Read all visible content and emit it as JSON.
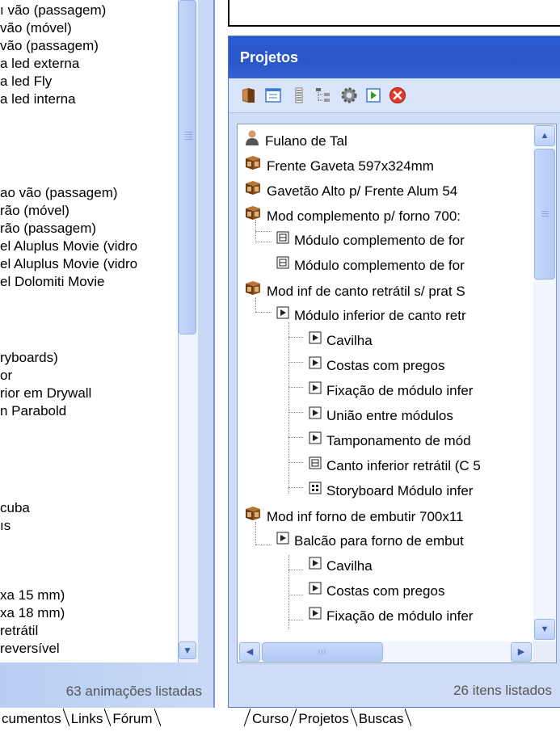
{
  "left_panel": {
    "items": [
      "ı vão (passagem)",
      "vão (móvel)",
      "vão (passagem)",
      "a led externa",
      "a led Fly",
      "a led interna",
      "",
      "",
      "",
      "ao vão (passagem)",
      "rão (móvel)",
      "rão (passagem)",
      "el Aluplus Movie (vidro",
      "el Aluplus Movie (vidro",
      "el Dolomiti Movie",
      "",
      "",
      "ryboards)",
      "or",
      "rior em Drywall",
      "n Parabold",
      "",
      "",
      "",
      "",
      " cuba",
      "ıs",
      "",
      "",
      "xa 15 mm)",
      "xa 18 mm)",
      " retrátil",
      " reversível"
    ],
    "status": "63 animações listadas"
  },
  "projects": {
    "title": "Projetos",
    "toolbar_icons": [
      "book-icon",
      "window-list-icon",
      "indent-icon",
      "tree-icon",
      "gear-icon",
      "play-icon",
      "close-icon"
    ],
    "tree_items": [
      "Fulano de Tal",
      "Frente Gaveta 597x324mm",
      "Gavetão Alto p/ Frente Alum 54",
      "Mod complemento p/ forno 700:",
      "Módulo complemento de for",
      "Módulo complemento de for",
      "Mod inf de canto retrátil s/ prat S",
      "Módulo inferior de canto retr",
      "Cavilha",
      "Costas com pregos",
      "Fixação de módulo infer",
      "União entre módulos",
      "Tamponamento de mód",
      "Canto inferior retrátil (C 5",
      "Storyboard Módulo infer",
      "Mod inf forno de embutir 700x11",
      "Balcão para forno de embut",
      "Cavilha",
      "Costas com pregos",
      "Fixação de módulo infer"
    ],
    "status": "26 itens listados"
  },
  "left_tabs": [
    "cumentos",
    "Links",
    "Fórum"
  ],
  "right_tabs": [
    "Curso",
    "Projetos",
    "Buscas"
  ],
  "scroll_glyphs": {
    "up": "▲",
    "down": "▼",
    "left": "◀",
    "right": "▶",
    "grip": "III"
  }
}
